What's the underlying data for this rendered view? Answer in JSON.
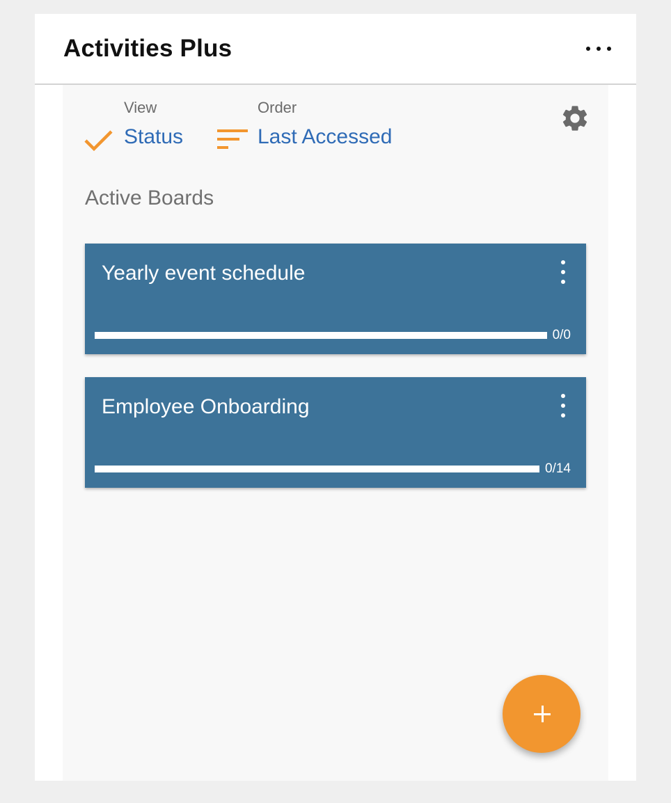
{
  "app": {
    "title": "Activities Plus",
    "more_icon": "more-horizontal-icon"
  },
  "filters": {
    "view": {
      "label": "View",
      "value": "Status",
      "icon": "check-icon",
      "icon_color": "#f2962f"
    },
    "order": {
      "label": "Order",
      "value": "Last Accessed",
      "icon": "sort-icon",
      "icon_color": "#f2962f"
    },
    "settings_icon": "gear-icon"
  },
  "section": {
    "title": "Active Boards"
  },
  "boards": [
    {
      "title": "Yearly event schedule",
      "progress_text": "0/0",
      "progress_fraction": 0
    },
    {
      "title": "Employee Onboarding",
      "progress_text": "0/14",
      "progress_fraction": 0
    }
  ],
  "fab": {
    "icon": "plus-icon"
  },
  "colors": {
    "card": "#3d7399",
    "accent": "#f2962f",
    "link": "#2f6bb6"
  }
}
